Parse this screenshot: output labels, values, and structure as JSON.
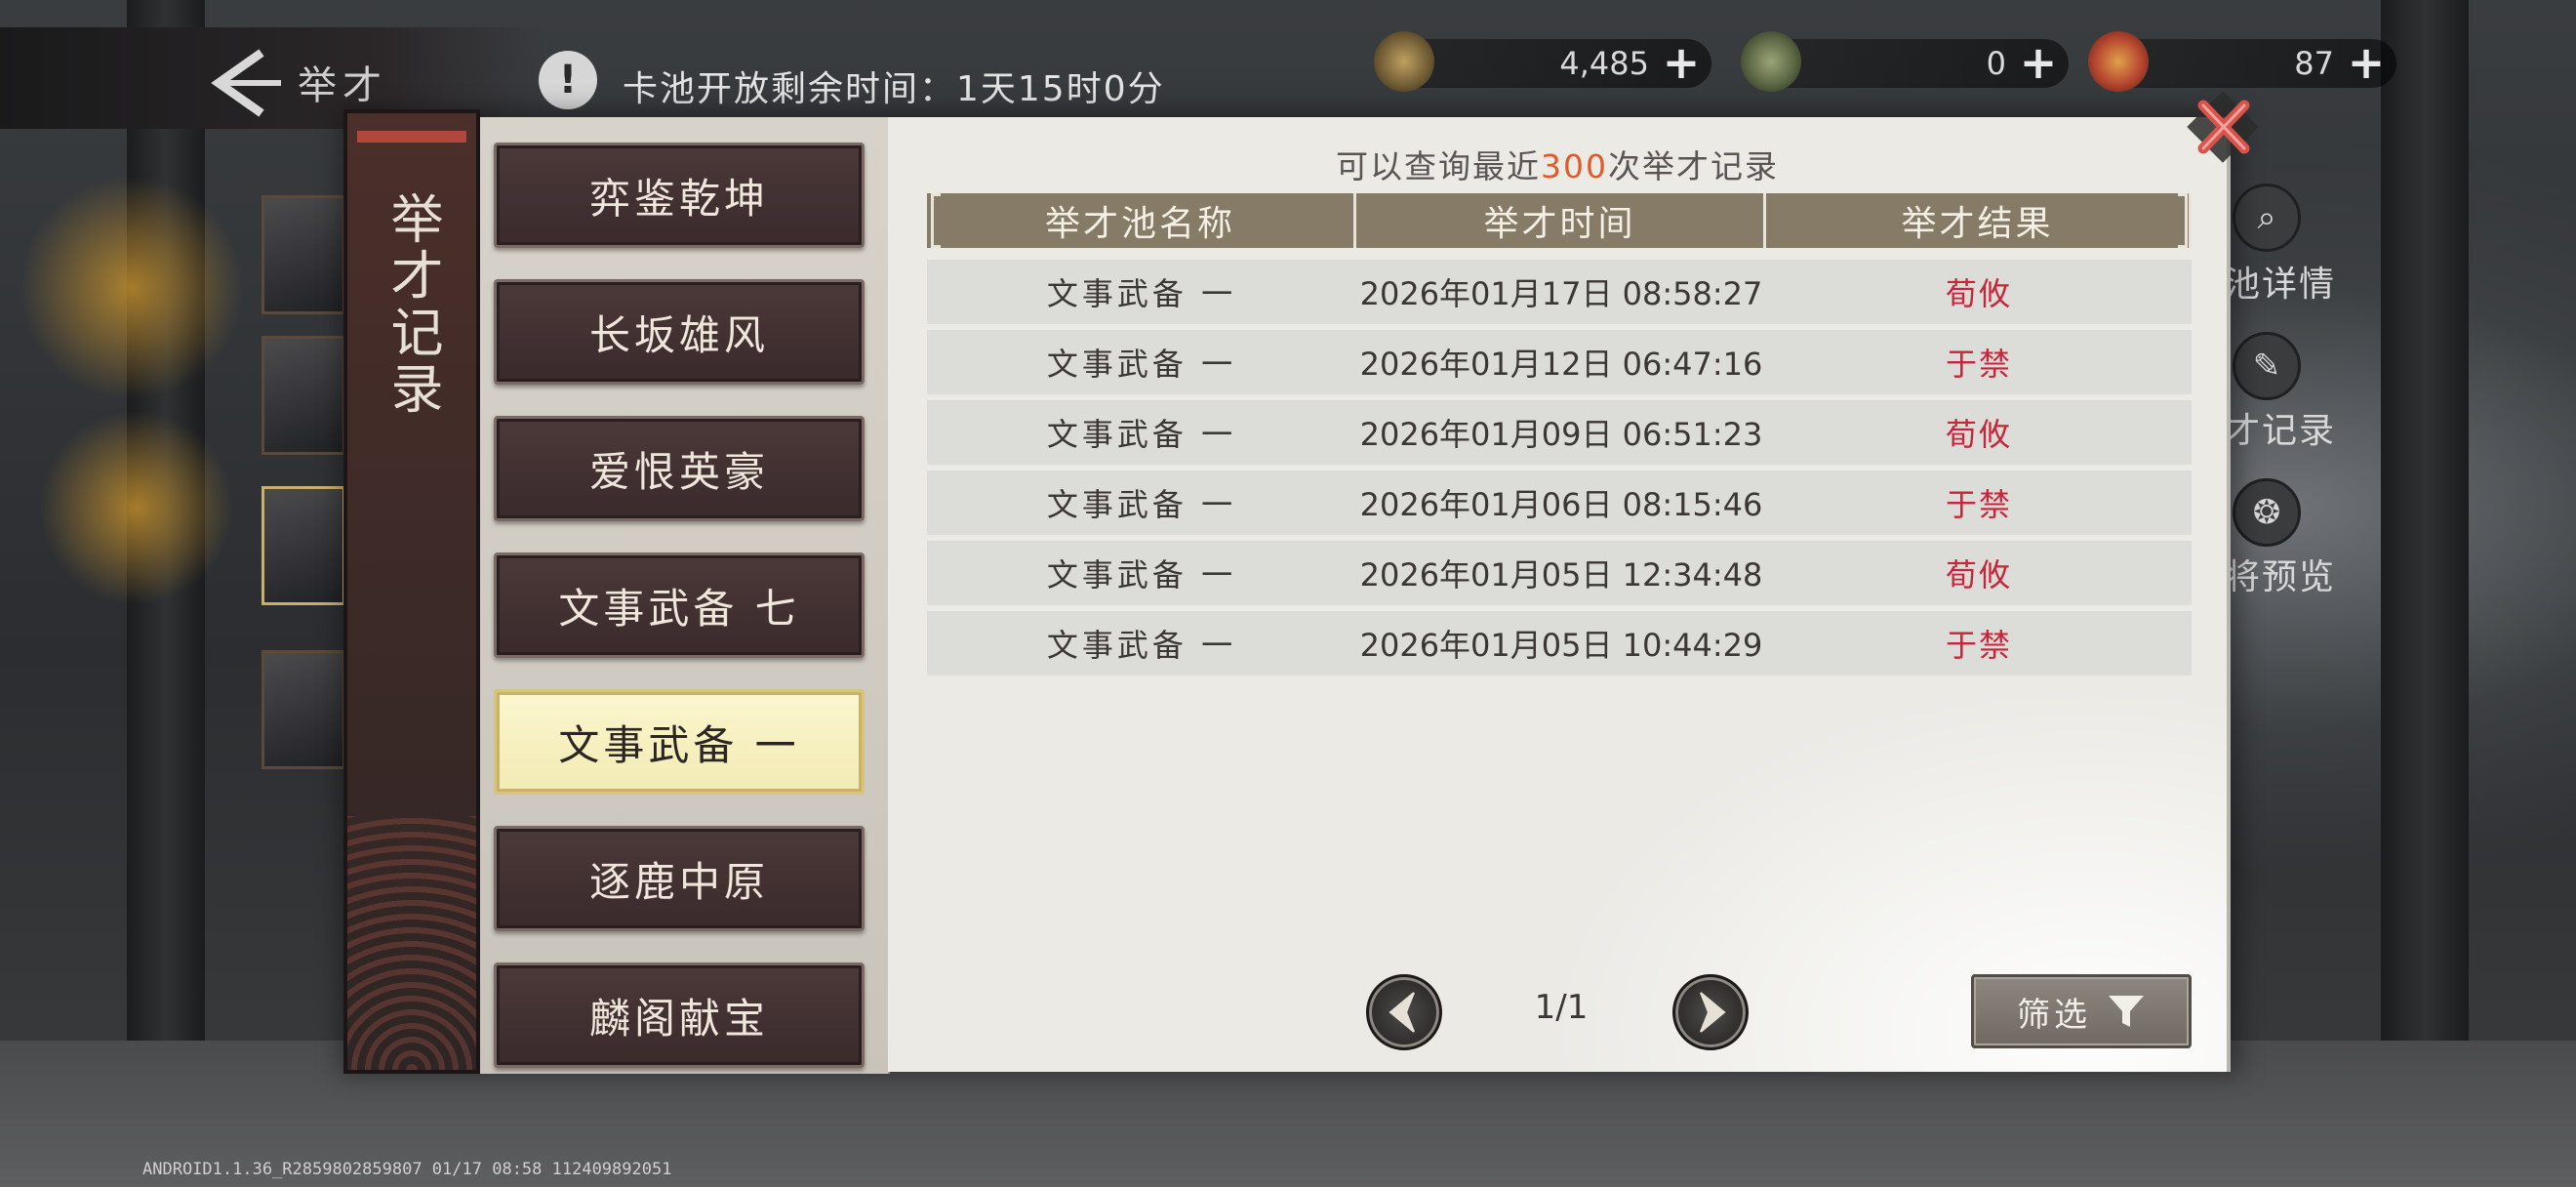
{
  "top_bar": {
    "title": "举才",
    "notice_text": "卡池开放剩余时间：1天15时0分"
  },
  "currencies": [
    {
      "icon": "copper-coin-icon",
      "value": "4,485"
    },
    {
      "icon": "jade-token-icon",
      "value": "0"
    },
    {
      "icon": "red-token-icon",
      "value": "87"
    }
  ],
  "side_menu_labels": [
    "池详情",
    "才记录",
    "将预览"
  ],
  "modal": {
    "banner_title": "举才记录",
    "caption_prefix": "可以查询最近",
    "caption_highlight": "300",
    "caption_suffix": "次举才记录",
    "pool_tabs": [
      {
        "label": "弈鉴乾坤",
        "active": false
      },
      {
        "label": "长坂雄风",
        "active": false
      },
      {
        "label": "爱恨英豪",
        "active": false
      },
      {
        "label": "文事武备 七",
        "active": false
      },
      {
        "label": "文事武备 一",
        "active": true
      },
      {
        "label": "逐鹿中原",
        "active": false
      },
      {
        "label": "麟阁献宝",
        "active": false
      }
    ],
    "table": {
      "columns": [
        "举才池名称",
        "举才时间",
        "举才结果"
      ],
      "rows": [
        {
          "pool": "文事武备 一",
          "time": "2026年01月17日 08:58:27",
          "result": "荀攸"
        },
        {
          "pool": "文事武备 一",
          "time": "2026年01月12日 06:47:16",
          "result": "于禁"
        },
        {
          "pool": "文事武备 一",
          "time": "2026年01月09日 06:51:23",
          "result": "荀攸"
        },
        {
          "pool": "文事武备 一",
          "time": "2026年01月06日 08:15:46",
          "result": "于禁"
        },
        {
          "pool": "文事武备 一",
          "time": "2026年01月05日 12:34:48",
          "result": "荀攸"
        },
        {
          "pool": "文事武备 一",
          "time": "2026年01月05日 10:44:29",
          "result": "于禁"
        }
      ]
    },
    "pagination": "1/1",
    "filter_label": "筛选"
  },
  "build_info": "ANDROID1.1.36_R2859802859807 01/17 08:58 112409892051",
  "colors": {
    "result_red": "#c8243a",
    "highlight_orange": "#e05a2a",
    "header_brown": "#857b66",
    "tab_dark": "#3a2a2b",
    "tab_active": "#f2ebb4"
  }
}
